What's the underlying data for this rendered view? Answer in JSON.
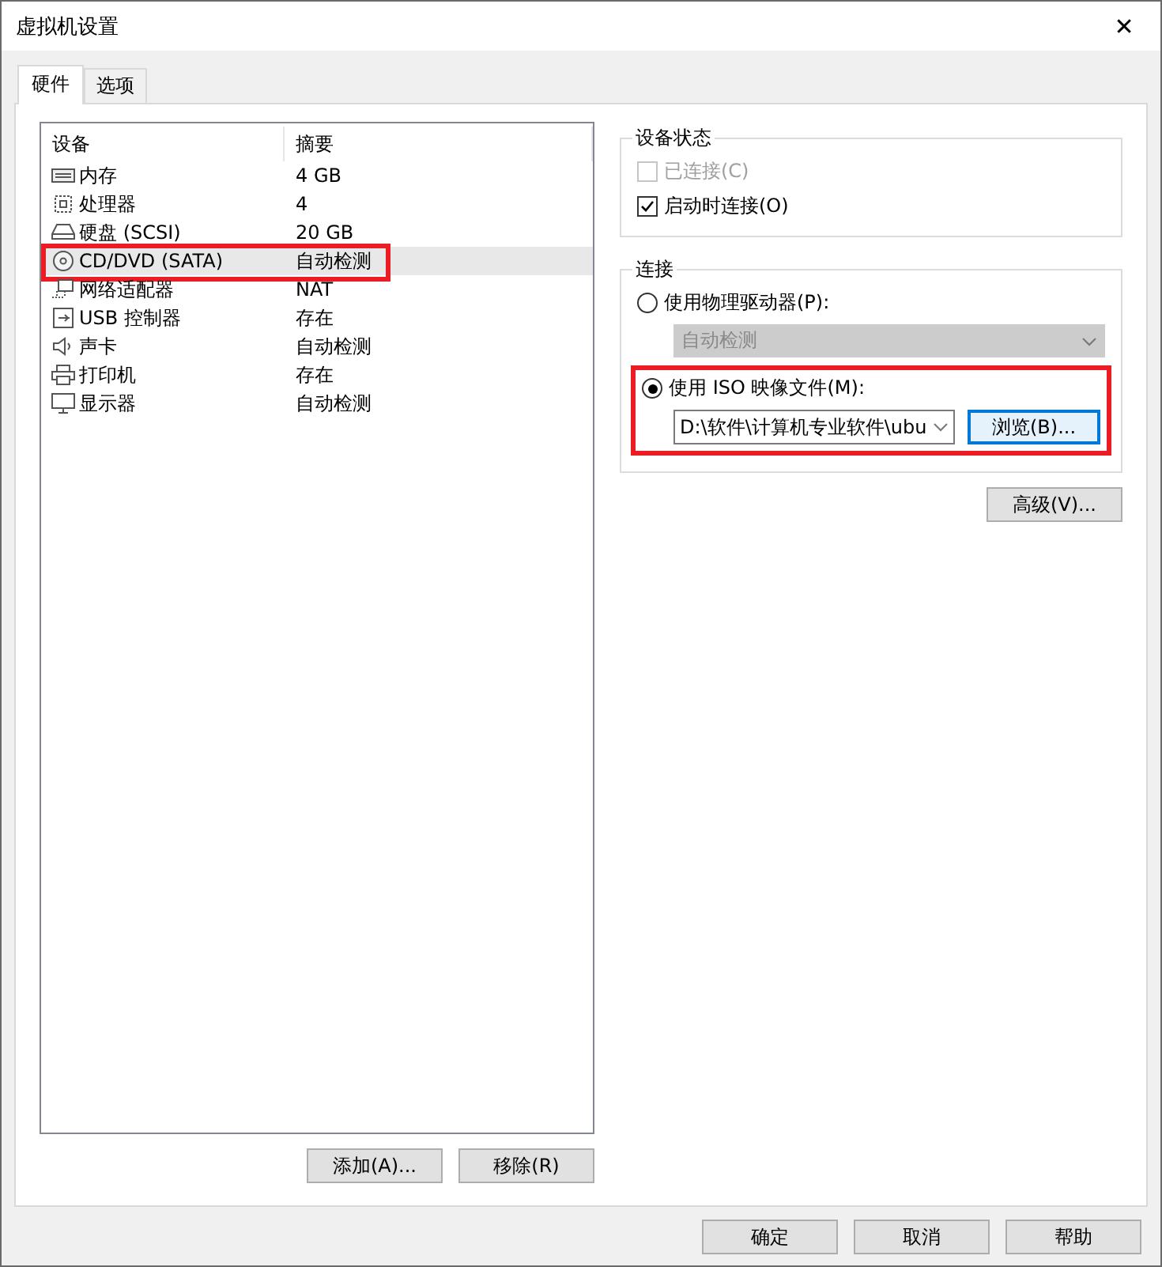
{
  "window": {
    "title": "虚拟机设置",
    "close": "✕"
  },
  "tabs": [
    {
      "label": "硬件",
      "selected": true
    },
    {
      "label": "选项",
      "selected": false
    }
  ],
  "device_table": {
    "columns": [
      "设备",
      "摘要"
    ],
    "rows": [
      {
        "kind": "memory",
        "device": "内存",
        "summary": "4 GB",
        "selected": false,
        "highlighted": false
      },
      {
        "kind": "cpu",
        "device": "处理器",
        "summary": "4",
        "selected": false,
        "highlighted": false
      },
      {
        "kind": "disk",
        "device": "硬盘 (SCSI)",
        "summary": "20 GB",
        "selected": false,
        "highlighted": false
      },
      {
        "kind": "cdrom",
        "device": "CD/DVD (SATA)",
        "summary": "自动检测",
        "selected": true,
        "highlighted": true
      },
      {
        "kind": "network",
        "device": "网络适配器",
        "summary": "NAT",
        "selected": false,
        "highlighted": false
      },
      {
        "kind": "usb",
        "device": "USB 控制器",
        "summary": "存在",
        "selected": false,
        "highlighted": false
      },
      {
        "kind": "sound",
        "device": "声卡",
        "summary": "自动检测",
        "selected": false,
        "highlighted": false
      },
      {
        "kind": "printer",
        "device": "打印机",
        "summary": "存在",
        "selected": false,
        "highlighted": false
      },
      {
        "kind": "display",
        "device": "显示器",
        "summary": "自动检测",
        "selected": false,
        "highlighted": false
      }
    ],
    "buttons": [
      "添加(A)...",
      "移除(R)"
    ]
  },
  "device_status": {
    "title": "设备状态",
    "options": [
      {
        "label": "已连接(C)",
        "checked": false,
        "disabled": true
      },
      {
        "label": "启动时连接(O)",
        "checked": true,
        "disabled": false
      }
    ]
  },
  "connection": {
    "title": "连接",
    "physical": {
      "label": "使用物理驱动器(P):",
      "selected": false,
      "dropdown": "自动检测",
      "disabled": true
    },
    "iso": {
      "label": "使用 ISO 映像文件(M):",
      "selected": true,
      "highlighted": true,
      "path": "D:\\软件\\计算机专业软件\\ubu",
      "browse": "浏览(B)..."
    }
  },
  "advanced_button": "高级(V)...",
  "footer_buttons": [
    "确定",
    "取消",
    "帮助"
  ]
}
